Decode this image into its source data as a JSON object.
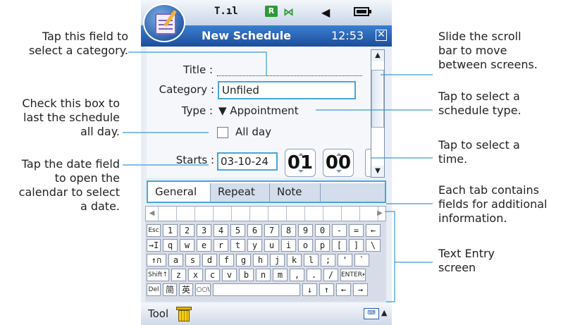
{
  "callouts": {
    "category": [
      "Tap this field to",
      "select a category."
    ],
    "allday": [
      "Check this box to",
      "last the schedule",
      "all day."
    ],
    "date": [
      "Tap the date field",
      "to open the",
      "calendar to select",
      "a date."
    ],
    "scroll": [
      "Slide the scroll",
      "bar to move",
      "between screens."
    ],
    "type": [
      "Tap to select a",
      "schedule type."
    ],
    "time": [
      "Tap to select a",
      "time."
    ],
    "tabs": [
      "Each tab contains",
      "fields for additional",
      "information."
    ],
    "text_entry": [
      "Text Entry",
      "screen"
    ]
  },
  "status": {
    "signal_icon": "signal-icon",
    "roaming": "R",
    "bluetooth": "⋈",
    "speaker": "◀",
    "battery_icon": "battery-icon"
  },
  "titlebar": {
    "title": "New Schedule",
    "time": "12:53",
    "close": "✕"
  },
  "form": {
    "title_label": "Title :",
    "title_value": "",
    "category_label": "Category :",
    "category_value": "Unfiled",
    "type_label": "Type :",
    "type_value": "▼  Appointment",
    "allday_label": "All day",
    "allday_checked": false,
    "starts_label": "Starts :",
    "date_value": "03-10-24",
    "hour_value": "01",
    "minute_value": "00"
  },
  "scrollbar": {
    "up": "▲",
    "down": "▼"
  },
  "tabs": [
    "General",
    "Repeat",
    "Note"
  ],
  "keyboard": {
    "rows": [
      [
        "Esc",
        "1",
        "2",
        "3",
        "4",
        "5",
        "6",
        "7",
        "8",
        "9",
        "0",
        "-",
        "=",
        "←"
      ],
      [
        "→I",
        "q",
        "w",
        "e",
        "r",
        "t",
        "y",
        "u",
        "i",
        "o",
        "p",
        "[",
        "]",
        "\\"
      ],
      [
        "↑ก",
        "a",
        "s",
        "d",
        "f",
        "g",
        "h",
        "j",
        "k",
        "l",
        ";",
        "'",
        "`"
      ],
      [
        "Shift↑",
        "z",
        "x",
        "c",
        "v",
        "b",
        "n",
        "m",
        ",",
        ".",
        "/",
        "ENTER↵"
      ],
      [
        "Del",
        "简",
        "英",
        "○○\\",
        "",
        "↓",
        "↑",
        "←",
        "→"
      ]
    ]
  },
  "bottombar": {
    "tool_label": "Tool",
    "trash_icon": "trash-icon",
    "keyboard_icon": "keyboard-icon",
    "menu_arrow": "▲"
  }
}
